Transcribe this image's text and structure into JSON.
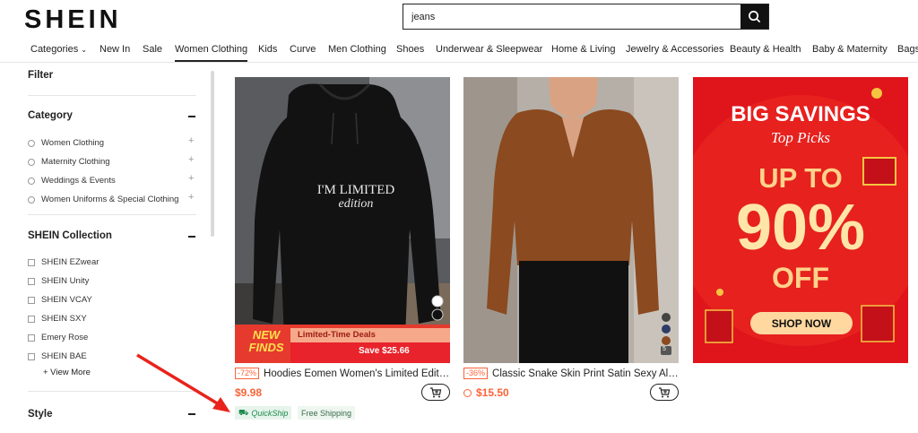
{
  "header": {
    "logo": "SHEIN",
    "search_value": "jeans",
    "search_icon": "search-icon"
  },
  "nav": {
    "items": [
      "Categories",
      "New In",
      "Sale",
      "Women Clothing",
      "Kids",
      "Curve",
      "Men Clothing",
      "Shoes",
      "Underwear & Sleepwear",
      "Home & Living",
      "Jewelry & Accessories",
      "Beauty & Health",
      "Baby & Maternity",
      "Bags"
    ],
    "active": "Women Clothing"
  },
  "sidebar": {
    "filter_title": "Filter",
    "category": {
      "title": "Category",
      "options": [
        "Women Clothing",
        "Maternity Clothing",
        "Weddings & Events",
        "Women Uniforms & Special Clothing"
      ]
    },
    "collection": {
      "title": "SHEIN Collection",
      "options": [
        "SHEIN EZwear",
        "SHEIN Unity",
        "SHEIN VCAY",
        "SHEIN SXY",
        "Emery Rose",
        "SHEIN BAE"
      ],
      "view_more": "+ View More"
    },
    "style_title": "Style"
  },
  "products": [
    {
      "discount": "-72%",
      "title": "Hoodies Eomen Women's Limited Edition...",
      "price": "$9.98",
      "print_line1": "I'M LIMITED",
      "print_line2": "edition",
      "banner_new": "NEW",
      "banner_finds": "FINDS",
      "banner_deal": "Limited-Time Deals",
      "banner_save": "Save $25.66",
      "tag_quickship": "QuickShip",
      "tag_free": "Free Shipping"
    },
    {
      "discount": "-36%",
      "title": "Classic Snake Skin Print Satin Sexy Alluri...",
      "price": "$15.50",
      "swatch_more": "5"
    }
  ],
  "promo": {
    "line1": "BIG SAVINGS",
    "line2": "Top Picks",
    "line3": "UP TO",
    "line4": "90%",
    "line5": "OFF",
    "button": "SHOP NOW"
  },
  "colors": {
    "accent": "#fa6338",
    "quickship_green": "#1e8a4c",
    "promo_red": "#e0141b"
  }
}
